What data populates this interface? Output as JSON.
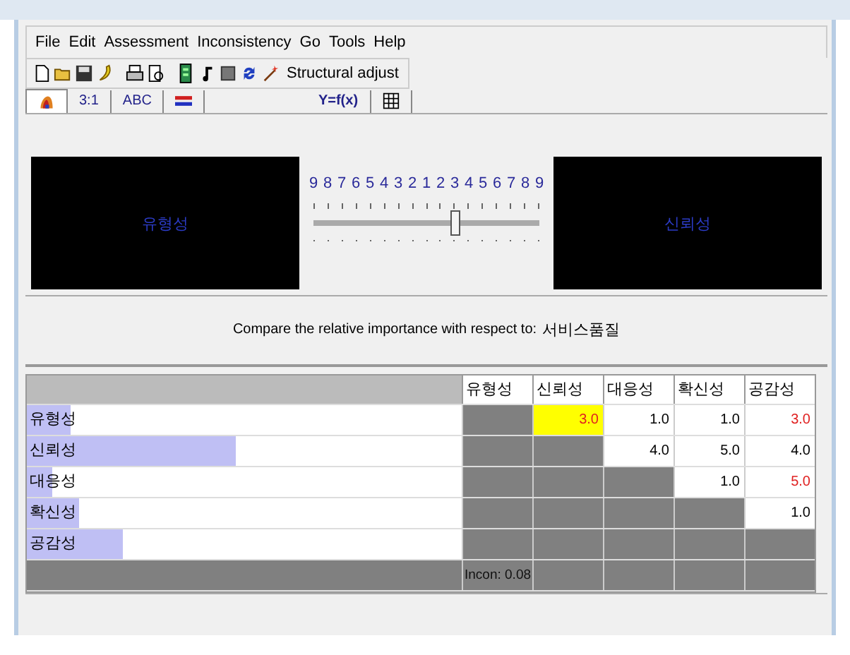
{
  "menu": [
    "File",
    "Edit",
    "Assessment",
    "Inconsistency",
    "Go",
    "Tools",
    "Help"
  ],
  "toolbar": {
    "button_label": "Structural adjust"
  },
  "tabs": [
    {
      "kind": "icon",
      "selected": true
    },
    {
      "kind": "text",
      "label": "3:1",
      "selected": false
    },
    {
      "kind": "text",
      "label": "ABC",
      "selected": false
    },
    {
      "kind": "icon",
      "selected": false
    },
    {
      "kind": "text",
      "label": "Y=f(x)",
      "selected": false
    },
    {
      "kind": "icon",
      "selected": false
    }
  ],
  "comparison": {
    "left": "유형성",
    "right": "신뢰성",
    "scale": [
      "9",
      "8",
      "7",
      "6",
      "5",
      "4",
      "3",
      "2",
      "1",
      "2",
      "3",
      "4",
      "5",
      "6",
      "7",
      "8",
      "9"
    ],
    "level": 0.625
  },
  "prompt": {
    "text": "Compare the relative importance  with respect to:",
    "goal": "서비스품질"
  },
  "matrix": {
    "columns": [
      "유형성",
      "신뢰성",
      "대응성",
      "확신성",
      "공감성"
    ],
    "rows": [
      {
        "name": "유형성",
        "level": 0.1,
        "cells": [
          "",
          {
            "value": "3.0",
            "inverted": true,
            "selected": true
          },
          {
            "value": "1.0",
            "inverted": false,
            "selected": false
          },
          {
            "value": "1.0",
            "inverted": false,
            "selected": false
          },
          {
            "value": "3.0",
            "inverted": true,
            "selected": false
          }
        ]
      },
      {
        "name": "신뢰성",
        "level": 0.48,
        "cells": [
          "",
          "",
          {
            "value": "4.0",
            "inverted": false,
            "selected": false
          },
          {
            "value": "5.0",
            "inverted": false,
            "selected": false
          },
          {
            "value": "4.0",
            "inverted": false,
            "selected": false
          }
        ]
      },
      {
        "name": "대응성",
        "level": 0.06,
        "cells": [
          "",
          "",
          "",
          {
            "value": "1.0",
            "inverted": false,
            "selected": false
          },
          {
            "value": "5.0",
            "inverted": true,
            "selected": false
          }
        ]
      },
      {
        "name": "확신성",
        "level": 0.12,
        "cells": [
          "",
          "",
          "",
          "",
          {
            "value": "1.0",
            "inverted": false,
            "selected": false
          }
        ]
      },
      {
        "name": "공감성",
        "level": 0.22,
        "cells": [
          "",
          "",
          "",
          "",
          ""
        ]
      }
    ],
    "inconsistency": "Incon: 0.08"
  }
}
